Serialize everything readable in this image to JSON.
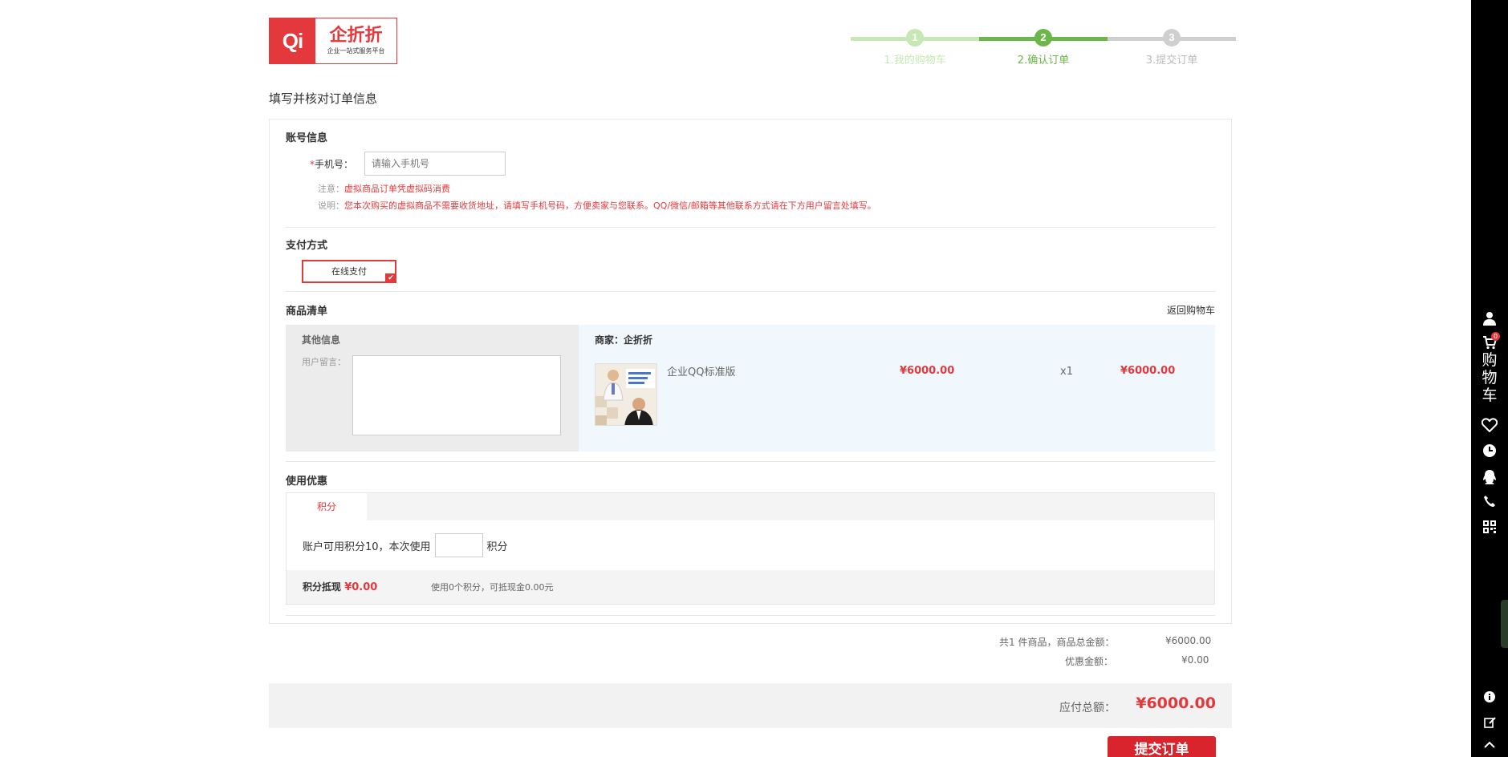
{
  "logo": {
    "mark": "Qi",
    "name": "企折折",
    "slogan": "企业一站式服务平台"
  },
  "steps": [
    {
      "num": "1",
      "label": "1.我的购物车"
    },
    {
      "num": "2",
      "label": "2.确认订单"
    },
    {
      "num": "3",
      "label": "3.提交订单"
    }
  ],
  "page_title": "填写并核对订单信息",
  "account": {
    "title": "账号信息",
    "required_mark": "*",
    "phone_label": "手机号：",
    "phone_placeholder": "请输入手机号",
    "note_label": "注意：",
    "note_text": "虚拟商品订单凭虚拟码消费",
    "desc_label": "说明：",
    "desc_text": "您本次购买的虚拟商品不需要收货地址，请填写手机号码，方便卖家与您联系。QQ/微信/邮箱等其他联系方式请在下方用户留言处填写。"
  },
  "payment": {
    "title": "支付方式",
    "option": "在线支付",
    "check": "✔"
  },
  "goods": {
    "title": "商品清单",
    "back_link": "返回购物车",
    "other_info": "其他信息",
    "message_label": "用户留言：",
    "merchant": "商家：企折折",
    "product_name": "企业QQ标准版",
    "unit_price": "¥6000.00",
    "qty": "x1",
    "subtotal": "¥6000.00"
  },
  "discount": {
    "title": "使用优惠",
    "tab": "积分",
    "points_prefix": "账户可用积分10，本次使用",
    "points_suffix": "积分",
    "deduct_label": "积分抵现",
    "deduct_value": "¥0.00",
    "deduct_note": "使用0个积分，可抵现金0.00元"
  },
  "summary": {
    "items_label": "共1 件商品，商品总金额：",
    "items_value": "¥6000.00",
    "discount_label": "优惠金额：",
    "discount_value": "¥0.00",
    "total_label": "应付总额：",
    "total_value": "¥6000.00",
    "submit": "提交订单"
  },
  "toolbar": {
    "cart_badge": "0",
    "cart_chars": [
      "购",
      "物",
      "车"
    ],
    "icons": [
      "user-icon",
      "cart-icon",
      "heart-icon",
      "clock-icon",
      "qq-icon",
      "phone-icon",
      "qrcode-icon",
      "info-icon",
      "edit-icon",
      "chevron-up-icon"
    ]
  },
  "colors": {
    "accent": "#e4393c",
    "step_active": "#6cb64a",
    "step_done": "#c5e8b4",
    "step_todo": "#cfcfcf"
  }
}
